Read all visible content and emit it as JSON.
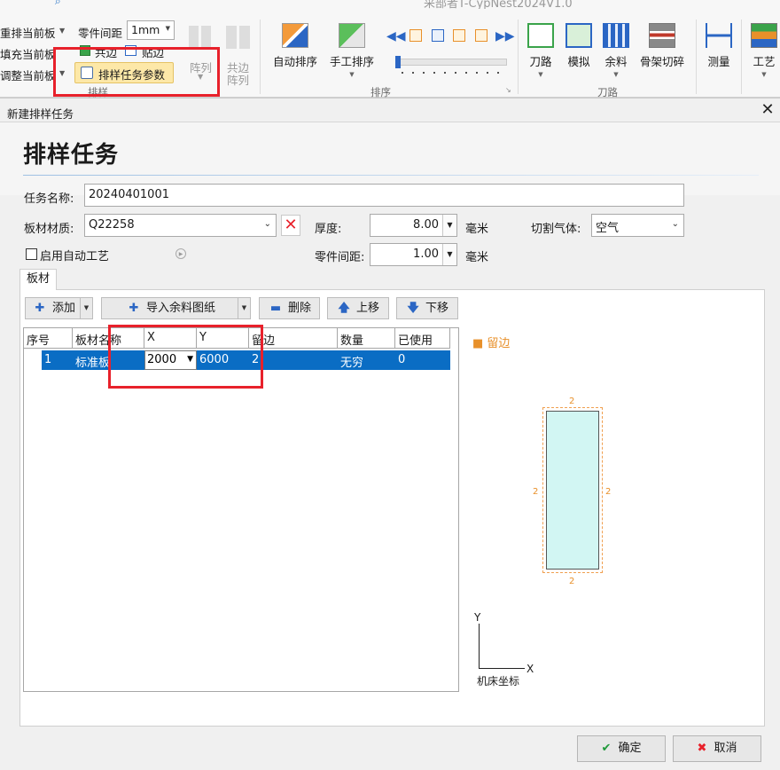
{
  "app": {
    "title": "采部者T-CypNest2024V1.0"
  },
  "ribbon": {
    "left_items": [
      "重排当前板",
      "填充当前板",
      "调整当前板"
    ],
    "part_spacing_label": "零件间距",
    "part_spacing_value": "1mm",
    "common_edge": "共边",
    "attach_edge": "贴边",
    "nest_task_param": "排样任务参数",
    "array": "阵列",
    "common_array_line1": "共边",
    "common_array_line2": "阵列",
    "group_nesting": "排样",
    "auto_nest": "自动排序",
    "manual_nest": "手工排序",
    "group_sort": "排序",
    "toolpath": "刀路",
    "simulate": "模拟",
    "remnant": "余料",
    "skeleton_cut": "骨架切碎",
    "group_toolpath": "刀路",
    "measure": "测量",
    "process": "工艺"
  },
  "dialog": {
    "title": "新建排样任务",
    "heading": "排样任务",
    "task_name_label": "任务名称:",
    "task_name_value": "20240401001",
    "material_label": "板材材质:",
    "material_value": "Q22258",
    "thickness_label": "厚度:",
    "thickness_value": "8.00",
    "unit_mm": "毫米",
    "gas_label": "切割气体:",
    "gas_value": "空气",
    "auto_process_label": "启用自动工艺",
    "part_spacing_label": "零件间距:",
    "part_spacing_value": "1.00",
    "tab_sheet": "板材",
    "btn_add": "添加",
    "btn_import": "导入余料图纸",
    "btn_delete": "删除",
    "btn_up": "上移",
    "btn_down": "下移",
    "table": {
      "headers": [
        "序号",
        "板材名称",
        "X",
        "Y",
        "留边",
        "数量",
        "已使用"
      ],
      "rows": [
        {
          "index": "1",
          "name": "标准板",
          "x": "2000",
          "y": "6000",
          "margin": "2",
          "qty": "无穷",
          "used": "0"
        }
      ]
    },
    "preview": {
      "legend": "留边",
      "margin_top": "2",
      "margin_bottom": "2",
      "margin_left": "2",
      "margin_right": "2",
      "axis_y": "Y",
      "axis_x": "X",
      "coord_label": "机床坐标"
    },
    "ok": "确定",
    "cancel": "取消"
  }
}
